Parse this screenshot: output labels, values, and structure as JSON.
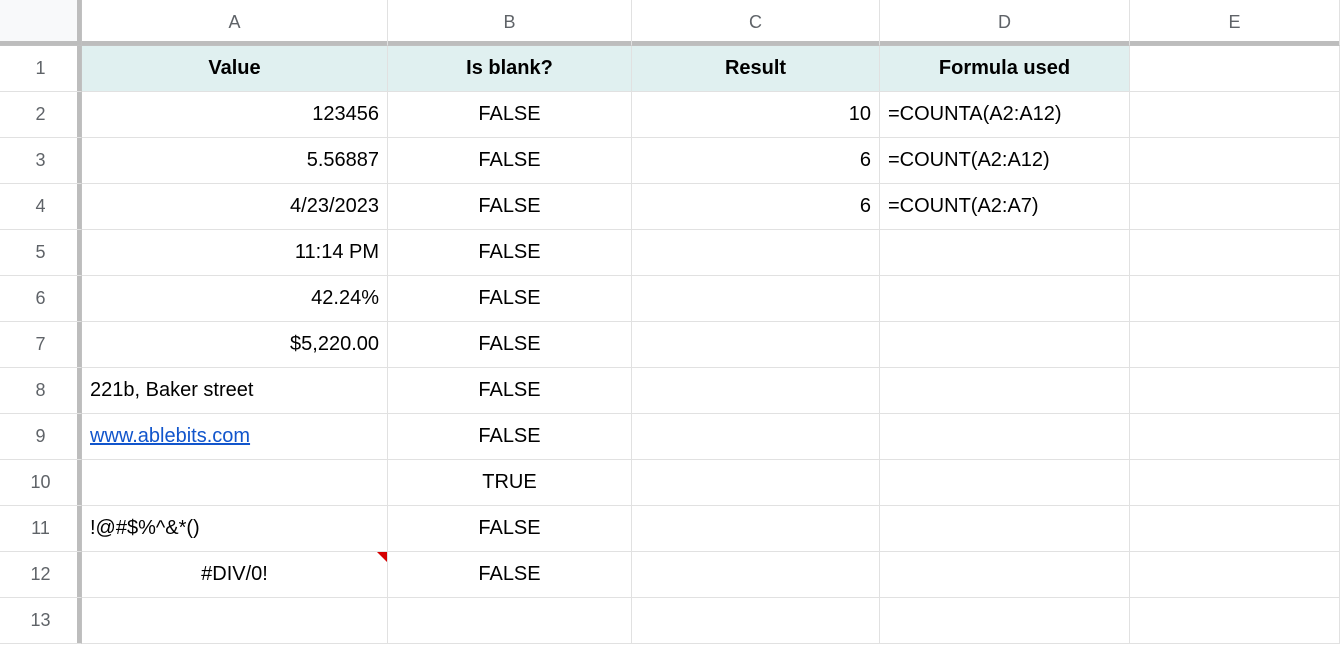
{
  "columns": [
    "A",
    "B",
    "C",
    "D",
    "E"
  ],
  "rowCount": 13,
  "headers": {
    "A": "Value",
    "B": "Is blank?",
    "C": "Result",
    "D": "Formula used"
  },
  "cells": {
    "A2": {
      "v": "123456",
      "align": "right"
    },
    "A3": {
      "v": "5.56887",
      "align": "right"
    },
    "A4": {
      "v": "4/23/2023",
      "align": "right"
    },
    "A5": {
      "v": "11:14 PM",
      "align": "right"
    },
    "A6": {
      "v": "42.24%",
      "align": "right"
    },
    "A7": {
      "v": "$5,220.00",
      "align": "right"
    },
    "A8": {
      "v": "221b, Baker street",
      "align": "left"
    },
    "A9": {
      "v": "www.ablebits.com",
      "align": "left",
      "link": true
    },
    "A10": {
      "v": "",
      "align": "left"
    },
    "A11": {
      "v": "!@#$%^&*()",
      "align": "left"
    },
    "A12": {
      "v": "#DIV/0!",
      "align": "center",
      "note": true
    },
    "B2": {
      "v": "FALSE",
      "align": "center"
    },
    "B3": {
      "v": "FALSE",
      "align": "center"
    },
    "B4": {
      "v": "FALSE",
      "align": "center"
    },
    "B5": {
      "v": "FALSE",
      "align": "center"
    },
    "B6": {
      "v": "FALSE",
      "align": "center"
    },
    "B7": {
      "v": "FALSE",
      "align": "center"
    },
    "B8": {
      "v": "FALSE",
      "align": "center"
    },
    "B9": {
      "v": "FALSE",
      "align": "center"
    },
    "B10": {
      "v": "TRUE",
      "align": "center"
    },
    "B11": {
      "v": "FALSE",
      "align": "center"
    },
    "B12": {
      "v": "FALSE",
      "align": "center"
    },
    "C2": {
      "v": "10",
      "align": "right"
    },
    "C3": {
      "v": "6",
      "align": "right"
    },
    "C4": {
      "v": "6",
      "align": "right"
    },
    "D2": {
      "v": "=COUNTA(A2:A12)",
      "align": "left"
    },
    "D3": {
      "v": "=COUNT(A2:A12)",
      "align": "left"
    },
    "D4": {
      "v": "=COUNT(A2:A7)",
      "align": "left"
    }
  }
}
